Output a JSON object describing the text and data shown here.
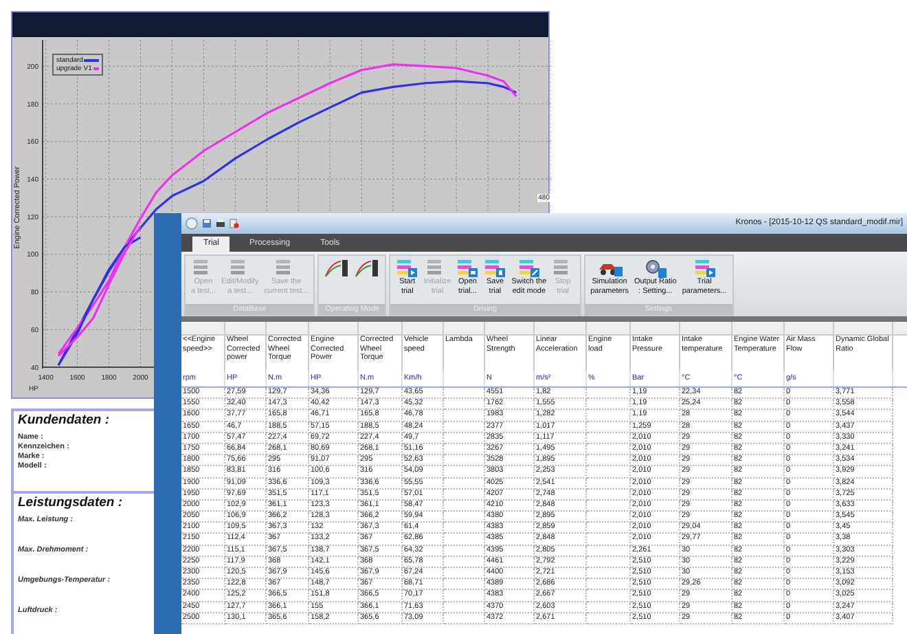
{
  "chart_window": {
    "corner_label": "480",
    "chart_data": {
      "type": "line",
      "xlabel": "HP",
      "ylabel": "Engine Corrected Power",
      "xlim": [
        1380,
        4600
      ],
      "ylim": [
        40,
        214
      ],
      "grid": true,
      "legend": "upper left",
      "xticks": [
        1400,
        1600,
        1800,
        2000
      ],
      "yticks": [
        40,
        60,
        80,
        100,
        120,
        140,
        160,
        180,
        200
      ],
      "x": [
        1480,
        1600,
        1700,
        1800,
        1900,
        2000,
        2100,
        2200,
        2400,
        2600,
        2800,
        3000,
        3200,
        3400,
        3600,
        3800,
        4000,
        4200,
        4300,
        4380
      ],
      "series": [
        {
          "name": "standard",
          "color": "#3030e8",
          "values": [
            41,
            60,
            76,
            91,
            104,
            114,
            124,
            131,
            139,
            151,
            161,
            170,
            178,
            186,
            189,
            191,
            192,
            191,
            189,
            186
          ]
        },
        {
          "name": "upgrade V1",
          "color": "#f030f0",
          "values": [
            47,
            61,
            73,
            86,
            104,
            119,
            133,
            142,
            155,
            165,
            175,
            183,
            191,
            198,
            201,
            200,
            199,
            195,
            192,
            184
          ]
        },
        {
          "color": "#3030e8",
          "values": [
            41,
            58,
            76,
            92,
            104,
            109,
            null,
            null,
            null,
            null,
            null,
            null,
            null,
            null,
            null,
            null,
            null,
            null,
            null,
            null
          ]
        },
        {
          "color": "#f030f0",
          "values": [
            46,
            56,
            66,
            84,
            101,
            115,
            null,
            null,
            null,
            null,
            null,
            null,
            null,
            null,
            null,
            null,
            null,
            null,
            null,
            null
          ]
        }
      ]
    }
  },
  "customer_sheet": {
    "sections": [
      {
        "title": "Kundendaten :",
        "kind": "plain",
        "fields": [
          "Name :",
          "Kennzeichen :",
          "Marke :",
          "Modell :"
        ]
      },
      {
        "title": "Leistungsdaten :",
        "kind": "spaced",
        "fields": [
          "Max. Leistung :",
          "Max. Drehmoment :",
          "Umgebungs-Temperatur :",
          "Luftdruck :"
        ]
      }
    ]
  },
  "app": {
    "title": "Kronos - [2015-10-12 QS standard_modif.mir]",
    "tabs": [
      {
        "label": "Trial",
        "selected": true
      },
      {
        "label": "Processing",
        "selected": false
      },
      {
        "label": "Tools",
        "selected": false
      }
    ],
    "ribbon_groups": [
      {
        "label": "DataBase",
        "buttons": [
          {
            "label": "Open\na test...",
            "kind": "stack",
            "disabled": true
          },
          {
            "label": "Edit/Modify\na test...",
            "kind": "stack",
            "disabled": true
          },
          {
            "label": "Save the\ncurrent test...",
            "kind": "stack",
            "disabled": true
          }
        ]
      },
      {
        "label": "Operating Mode",
        "buttons": [
          {
            "kind": "graph"
          },
          {
            "kind": "graph"
          }
        ]
      },
      {
        "label": "Driving",
        "buttons": [
          {
            "label": "Start\ntrial",
            "kind": "play",
            "disabled": false
          },
          {
            "label": "Initialize\ntrial",
            "kind": "stack",
            "disabled": true
          },
          {
            "label": "Open\ntrial...",
            "kind": "open",
            "disabled": false
          },
          {
            "label": "Save\ntrial",
            "kind": "save",
            "disabled": false
          },
          {
            "label": "Switch the\nedit mode",
            "kind": "edit",
            "disabled": false
          },
          {
            "label": "Stop\ntrial",
            "kind": "stack",
            "disabled": true
          }
        ]
      },
      {
        "label": "Settings",
        "buttons": [
          {
            "label": "Simulation\nparameters",
            "kind": "car",
            "disabled": false
          },
          {
            "label": "Output Ratio\n: Setting...",
            "kind": "gear",
            "disabled": false
          },
          {
            "label": "Trial\nparameters...",
            "kind": "play",
            "disabled": false
          }
        ]
      }
    ],
    "table": {
      "columns": [
        {
          "name": "<<Engine speed>>",
          "unit": "rpm"
        },
        {
          "name": "Wheel Corrected power",
          "unit": "HP"
        },
        {
          "name": "Corrected Wheel Torque",
          "unit": "N.m"
        },
        {
          "name": "Engine Corrected Power",
          "unit": "HP"
        },
        {
          "name": "Corrected Wheel Torque",
          "unit": "N.m"
        },
        {
          "name": "Vehicle speed",
          "unit": "Km/h"
        },
        {
          "name": "Lambda"
        },
        {
          "name": "Wheel Strength",
          "unit": "N"
        },
        {
          "name": "Linear Acceleration",
          "unit": "m/s²"
        },
        {
          "name": "Engine load",
          "unit": "%"
        },
        {
          "name": "Intake Pressure",
          "unit": "Bar"
        },
        {
          "name": "Intake temperature",
          "unit": "°C"
        },
        {
          "name": "Engine Water Temperature",
          "unit": "°C"
        },
        {
          "name": "Air Mass Flow",
          "unit": "g/s"
        },
        {
          "name": "Dynamic Global Ratio"
        }
      ],
      "rows": [
        [
          "1500",
          "27,59",
          "129,7",
          "34,36",
          "129,7",
          "43,65",
          "",
          "4551",
          "1,82",
          "",
          "1,19",
          "22,34",
          "82",
          "0",
          "3,771"
        ],
        [
          "1550",
          "32,40",
          "147,3",
          "40,42",
          "147,3",
          "45,32",
          "",
          "1762",
          "1,555",
          "",
          "1,19",
          "25,24",
          "82",
          "0",
          "3,558"
        ],
        [
          "1600",
          "37,77",
          "165,8",
          "46,71",
          "165,8",
          "46,78",
          "",
          "1983",
          "1,282",
          "",
          "1,19",
          "28",
          "82",
          "0",
          "3,544"
        ],
        [
          "1650",
          "46,7",
          "188,5",
          "57,15",
          "188,5",
          "48,24",
          "",
          "2377",
          "1,017",
          "",
          "1,259",
          "28",
          "82",
          "0",
          "3,437"
        ],
        [
          "1700",
          "57,47",
          "227,4",
          "69,72",
          "227,4",
          "49,7",
          "",
          "2835",
          "1,117",
          "",
          "2,010",
          "29",
          "82",
          "0",
          "3,330"
        ],
        [
          "1750",
          "66,84",
          "268,1",
          "80,69",
          "268,1",
          "51,16",
          "",
          "3267",
          "1,495",
          "",
          "2,010",
          "29",
          "82",
          "0",
          "3,241"
        ],
        [
          "1800",
          "75,66",
          "295",
          "91,07",
          "295",
          "52,63",
          "",
          "3528",
          "1,895",
          "",
          "2,010",
          "29",
          "82",
          "0",
          "3,534"
        ],
        [
          "1850",
          "83,81",
          "316",
          "100,6",
          "316",
          "54,09",
          "",
          "3803",
          "2,253",
          "",
          "2,010",
          "29",
          "82",
          "0",
          "3,929"
        ],
        [
          "1900",
          "91,09",
          "336,6",
          "109,3",
          "336,6",
          "55,55",
          "",
          "4025",
          "2,541",
          "",
          "2,010",
          "29",
          "82",
          "0",
          "3,824"
        ],
        [
          "1950",
          "97,69",
          "351,5",
          "117,1",
          "351,5",
          "57,01",
          "",
          "4207",
          "2,748",
          "",
          "2,010",
          "29",
          "82",
          "0",
          "3,725"
        ],
        [
          "2000",
          "102,9",
          "361,1",
          "123,3",
          "361,1",
          "58,47",
          "",
          "4210",
          "2,848",
          "",
          "2,010",
          "29",
          "82",
          "0",
          "3,633"
        ],
        [
          "2050",
          "106,9",
          "366,2",
          "128,3",
          "366,2",
          "59,94",
          "",
          "4380",
          "2,895",
          "",
          "2,010",
          "29",
          "82",
          "0",
          "3,545"
        ],
        [
          "2100",
          "109,5",
          "367,3",
          "132",
          "367,3",
          "61,4",
          "",
          "4383",
          "2,859",
          "",
          "2,010",
          "29,04",
          "82",
          "0",
          "3,45"
        ],
        [
          "2150",
          "112,4",
          "367",
          "133,2",
          "367",
          "62,86",
          "",
          "4385",
          "2,848",
          "",
          "2,010",
          "29,77",
          "82",
          "0",
          "3,38"
        ],
        [
          "2200",
          "115,1",
          "367,5",
          "138,7",
          "367,5",
          "64,32",
          "",
          "4395",
          "2,805",
          "",
          "2,261",
          "30",
          "82",
          "0",
          "3,303"
        ],
        [
          "2250",
          "117,9",
          "368",
          "142,1",
          "368",
          "65,78",
          "",
          "4461",
          "2,792",
          "",
          "2,510",
          "30",
          "82",
          "0",
          "3,229"
        ],
        [
          "2300",
          "120,5",
          "367,9",
          "145,6",
          "367,9",
          "67,24",
          "",
          "4400",
          "2,721",
          "",
          "2,510",
          "30",
          "82",
          "0",
          "3,153"
        ],
        [
          "2350",
          "122,8",
          "367",
          "148,7",
          "367",
          "68,71",
          "",
          "4389",
          "2,686",
          "",
          "2,510",
          "29,26",
          "82",
          "0",
          "3,092"
        ],
        [
          "2400",
          "125,2",
          "366,5",
          "151,8",
          "366,5",
          "70,17",
          "",
          "4383",
          "2,667",
          "",
          "2,510",
          "29",
          "82",
          "0",
          "3,025"
        ],
        [
          "2450",
          "127,7",
          "366,1",
          "155",
          "366,1",
          "71,63",
          "",
          "4370",
          "2,603",
          "",
          "2,510",
          "29",
          "82",
          "0",
          "3,247"
        ],
        [
          "2500",
          "130,1",
          "365,6",
          "158,2",
          "365,6",
          "73,09",
          "",
          "4372",
          "2,671",
          "",
          "2,510",
          "29",
          "82",
          "0",
          "3,407"
        ]
      ]
    }
  }
}
